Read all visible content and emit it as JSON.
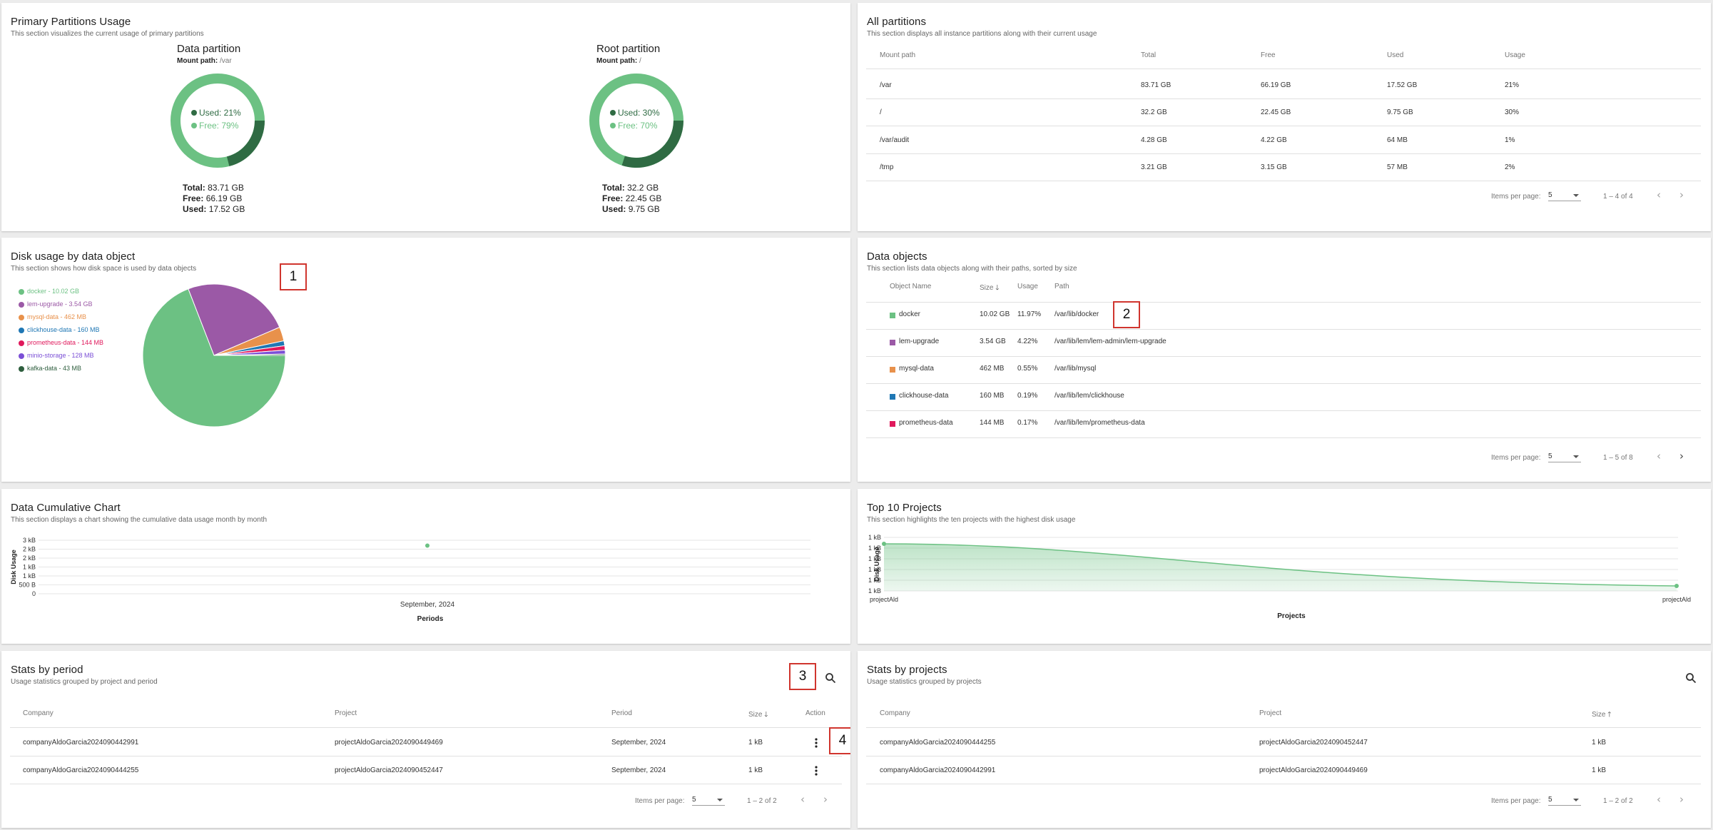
{
  "primary": {
    "title": "Primary Partitions Usage",
    "subtitle": "This section visualizes the current usage of primary partitions",
    "data": {
      "title": "Data partition",
      "mount_label": "Mount path:",
      "mount": "/var",
      "used": "Used: 21%",
      "free": "Free: 79%",
      "used_fraction": 0.21,
      "total_label": "Total:",
      "total": "83.71 GB",
      "free_label": "Free:",
      "free_val": "66.19 GB",
      "used_label": "Used:",
      "used_val": "17.52 GB"
    },
    "root": {
      "title": "Root partition",
      "mount_label": "Mount path:",
      "mount": "/",
      "used": "Used: 30%",
      "free": "Free: 70%",
      "used_fraction": 0.3,
      "total_label": "Total:",
      "total": "32.2 GB",
      "free_label": "Free:",
      "free_val": "22.45 GB",
      "used_label": "Used:",
      "used_val": "9.75 GB"
    }
  },
  "partitions": {
    "title": "All partitions",
    "subtitle": "This section displays all instance partitions along with their current usage",
    "headers": [
      "Mount path",
      "Total",
      "Free",
      "Used",
      "Usage"
    ],
    "rows": [
      [
        "/var",
        "83.71 GB",
        "66.19 GB",
        "17.52 GB",
        "21%"
      ],
      [
        "/",
        "32.2 GB",
        "22.45 GB",
        "9.75 GB",
        "30%"
      ],
      [
        "/var/audit",
        "4.28 GB",
        "4.22 GB",
        "64 MB",
        "1%"
      ],
      [
        "/tmp",
        "3.21 GB",
        "3.15 GB",
        "57 MB",
        "2%"
      ]
    ],
    "items_per_page_label": "Items per page:",
    "items_per_page": "5",
    "range": "1 – 4 of 4"
  },
  "disk_usage": {
    "title": "Disk usage by data object",
    "subtitle": "This section shows how disk space is used by data objects",
    "legend": [
      {
        "label": "docker - 10.02 GB",
        "color": "#6cc183"
      },
      {
        "label": "lem-upgrade - 3.54 GB",
        "color": "#9b59a6"
      },
      {
        "label": "mysql-data - 462 MB",
        "color": "#e8914b"
      },
      {
        "label": "clickhouse-data - 160 MB",
        "color": "#1f77b4"
      },
      {
        "label": "prometheus-data - 144 MB",
        "color": "#e0195c"
      },
      {
        "label": "minio-storage - 128 MB",
        "color": "#7b4fd6"
      },
      {
        "label": "kafka-data - 43 MB",
        "color": "#2e5e3e"
      }
    ],
    "callout": "1"
  },
  "data_objects": {
    "title": "Data objects",
    "subtitle": "This section lists data objects along with their paths, sorted by size",
    "headers": [
      "Object Name",
      "Size",
      "Usage",
      "Path"
    ],
    "rows": [
      {
        "color": "#6cc183",
        "name": "docker",
        "size": "10.02 GB",
        "usage": "11.97%",
        "path": "/var/lib/docker"
      },
      {
        "color": "#9b59a6",
        "name": "lem-upgrade",
        "size": "3.54 GB",
        "usage": "4.22%",
        "path": "/var/lib/lem/lem-admin/lem-upgrade"
      },
      {
        "color": "#e8914b",
        "name": "mysql-data",
        "size": "462 MB",
        "usage": "0.55%",
        "path": "/var/lib/mysql"
      },
      {
        "color": "#1f77b4",
        "name": "clickhouse-data",
        "size": "160 MB",
        "usage": "0.19%",
        "path": "/var/lib/lem/clickhouse"
      },
      {
        "color": "#e0195c",
        "name": "prometheus-data",
        "size": "144 MB",
        "usage": "0.17%",
        "path": "/var/lib/lem/prometheus-data"
      }
    ],
    "items_per_page_label": "Items per page:",
    "items_per_page": "5",
    "range": "1 – 5 of 8",
    "callout": "2"
  },
  "cumulative": {
    "title": "Data Cumulative Chart",
    "subtitle": "This section displays a chart showing the cumulative data usage month by month"
  },
  "top_projects": {
    "title": "Top 10 Projects",
    "subtitle": "This section highlights the ten projects with the highest disk usage"
  },
  "chart_data": [
    {
      "type": "pie",
      "categories": [
        "docker",
        "lem-upgrade",
        "mysql-data",
        "clickhouse-data",
        "prometheus-data",
        "minio-storage",
        "kafka-data"
      ],
      "values": [
        10.02,
        3.54,
        0.462,
        0.16,
        0.144,
        0.128,
        0.043
      ],
      "unit": "GB",
      "colors": [
        "#6cc183",
        "#9b59a6",
        "#e8914b",
        "#1f77b4",
        "#e0195c",
        "#7b4fd6",
        "#2e5e3e"
      ]
    },
    {
      "type": "scatter",
      "x": [
        "September, 2024"
      ],
      "values": [
        2.7
      ],
      "xlabel": "Periods",
      "ylabel": "Disk Usage",
      "yticks": [
        "3 kB",
        "2 kB",
        "2 kB",
        "1 kB",
        "1 kB",
        "500 B",
        "0"
      ],
      "ylim": [
        0,
        3
      ],
      "grid": true
    },
    {
      "type": "area",
      "x": [
        "projectAld",
        "projectAld"
      ],
      "values": [
        1.0,
        1.0
      ],
      "xlabel": "Projects",
      "ylabel": "Disk Usage",
      "yticks": [
        "1 kB",
        "1 kB",
        "1 kB",
        "1 kB",
        "1 kB",
        "1 kB"
      ],
      "grid": true
    }
  ],
  "stats_period": {
    "title": "Stats by period",
    "subtitle": "Usage statistics grouped by project and period",
    "headers": [
      "Company",
      "Project",
      "Period",
      "Size",
      "Action"
    ],
    "rows": [
      [
        "companyAldoGarcia2024090442991",
        "projectAldoGarcia2024090449469",
        "September, 2024",
        "1 kB"
      ],
      [
        "companyAldoGarcia2024090444255",
        "projectAldoGarcia2024090452447",
        "September, 2024",
        "1 kB"
      ]
    ],
    "items_per_page_label": "Items per page:",
    "items_per_page": "5",
    "range": "1 – 2 of 2",
    "callout_search": "3",
    "callout_action": "4"
  },
  "stats_projects": {
    "title": "Stats by projects",
    "subtitle": "Usage statistics grouped by projects",
    "headers": [
      "Company",
      "Project",
      "Size"
    ],
    "rows": [
      [
        "companyAldoGarcia2024090444255",
        "projectAldoGarcia2024090452447",
        "1 kB"
      ],
      [
        "companyAldoGarcia2024090442991",
        "projectAldoGarcia2024090449469",
        "1 kB"
      ]
    ],
    "items_per_page_label": "Items per page:",
    "items_per_page": "5",
    "range": "1 – 2 of 2"
  }
}
